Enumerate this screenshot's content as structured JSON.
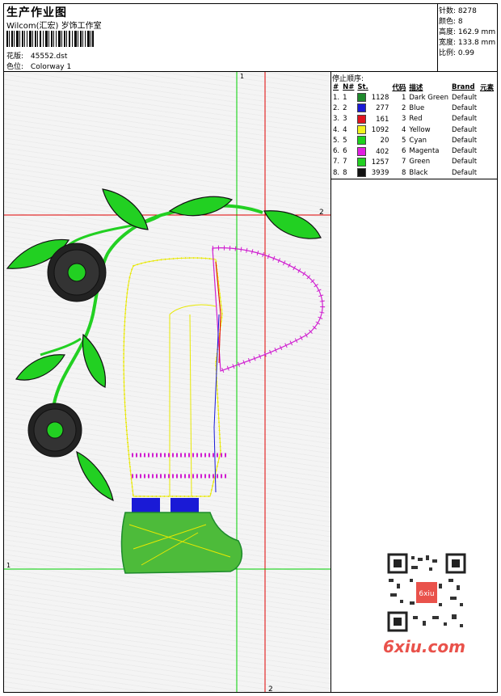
{
  "header": {
    "title": "生产作业图",
    "company": "Wilcom(汇宏) 岁饰工作室",
    "design_label": "花版:",
    "design_value": "45552.dst",
    "colorway_label": "色位:",
    "colorway_value": "Colorway 1"
  },
  "stats": [
    {
      "label": "针数:",
      "value": "8278"
    },
    {
      "label": "颜色:",
      "value": "8"
    },
    {
      "label": "高度:",
      "value": "162.9 mm"
    },
    {
      "label": "宽度:",
      "value": "133.8 mm"
    },
    {
      "label": "比例:",
      "value": "0.99"
    }
  ],
  "stop_sequence": {
    "title": "停止顺序:",
    "columns": [
      "#",
      "N#",
      "St.",
      "代码",
      "描述",
      "Brand",
      "元素"
    ],
    "rows": [
      {
        "num": "1.",
        "n": "1",
        "color": "#1e8a2c",
        "stitches": "1128",
        "code": "1",
        "desc": "Dark Green",
        "brand": "Default"
      },
      {
        "num": "2.",
        "n": "2",
        "color": "#1a1ad6",
        "stitches": "277",
        "code": "2",
        "desc": "Blue",
        "brand": "Default"
      },
      {
        "num": "3.",
        "n": "3",
        "color": "#e0141e",
        "stitches": "161",
        "code": "3",
        "desc": "Red",
        "brand": "Default"
      },
      {
        "num": "4.",
        "n": "4",
        "color": "#f2f21e",
        "stitches": "1092",
        "code": "4",
        "desc": "Yellow",
        "brand": "Default"
      },
      {
        "num": "5.",
        "n": "5",
        "color": "#1ed21e",
        "stitches": "20",
        "code": "5",
        "desc": "Cyan",
        "brand": "Default"
      },
      {
        "num": "6.",
        "n": "6",
        "color": "#e21ee2",
        "stitches": "402",
        "code": "6",
        "desc": "Magenta",
        "brand": "Default"
      },
      {
        "num": "7.",
        "n": "7",
        "color": "#22d022",
        "stitches": "1257",
        "code": "7",
        "desc": "Green",
        "brand": "Default"
      },
      {
        "num": "8.",
        "n": "8",
        "color": "#111111",
        "stitches": "3939",
        "code": "8",
        "desc": "Black",
        "brand": "Default"
      }
    ]
  },
  "guides": {
    "top_label_1": "1",
    "right_label_2": "2",
    "left_label_1": "1",
    "bottom_label_2": "2"
  },
  "watermark": {
    "qr_stamp": "6xiu",
    "site": "6xiu.com"
  },
  "colors": {
    "guide_green": "#00d000",
    "guide_red": "#e00000",
    "watermark_red": "#e9524b"
  }
}
